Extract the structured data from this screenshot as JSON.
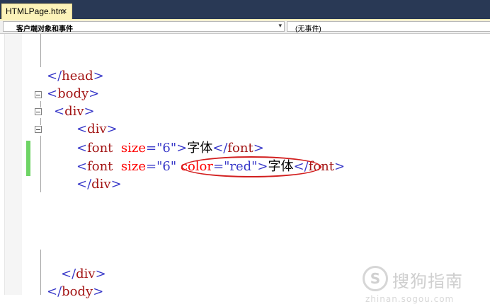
{
  "tab": {
    "title": "HTMLPage.htm",
    "close_glyph": "×"
  },
  "navbar": {
    "left_select": "客户端对象和事件",
    "left_arrow": "▾",
    "right_select": "(无事件)"
  },
  "code": {
    "l1": {
      "open": "</",
      "tag": "head",
      "close": ">"
    },
    "l2": {
      "open": "<",
      "tag": "body",
      "close": ">"
    },
    "l3": {
      "open": "<",
      "tag": "div",
      "close": ">"
    },
    "l4": {
      "open": "<",
      "tag": "div",
      "close": ">"
    },
    "l5": {
      "open": "<",
      "tag": "font",
      "attr": "size",
      "eq": "=",
      "val": "\"6\"",
      "close": ">",
      "text": "字体",
      "end_open": "</",
      "end_tag": "font",
      "end_close": ">"
    },
    "l6": {
      "open": "<",
      "tag": "font",
      "attr1": "size",
      "eq1": "=",
      "val1": "\"6\"",
      "attr2": "color",
      "eq2": "=",
      "val2": "\"red\"",
      "close": ">",
      "text": "字体",
      "end_open": "</",
      "end_tag": "font",
      "end_close": ">"
    },
    "l7": {
      "open": "</",
      "tag": "div",
      "close": ">"
    },
    "l8": {
      "open": "</",
      "tag": "div",
      "close": ">"
    },
    "l9": {
      "open": "</",
      "tag": "body",
      "close": ">"
    }
  },
  "watermark": {
    "icon": "S",
    "name": "搜狗指南",
    "url": "zhinan.sogou.com"
  },
  "colors": {
    "tag_bracket": "#3737c8",
    "element": "#a31515",
    "attribute": "#ff0000",
    "changed_line": "#6ed465",
    "annotation": "#d21f1f"
  }
}
